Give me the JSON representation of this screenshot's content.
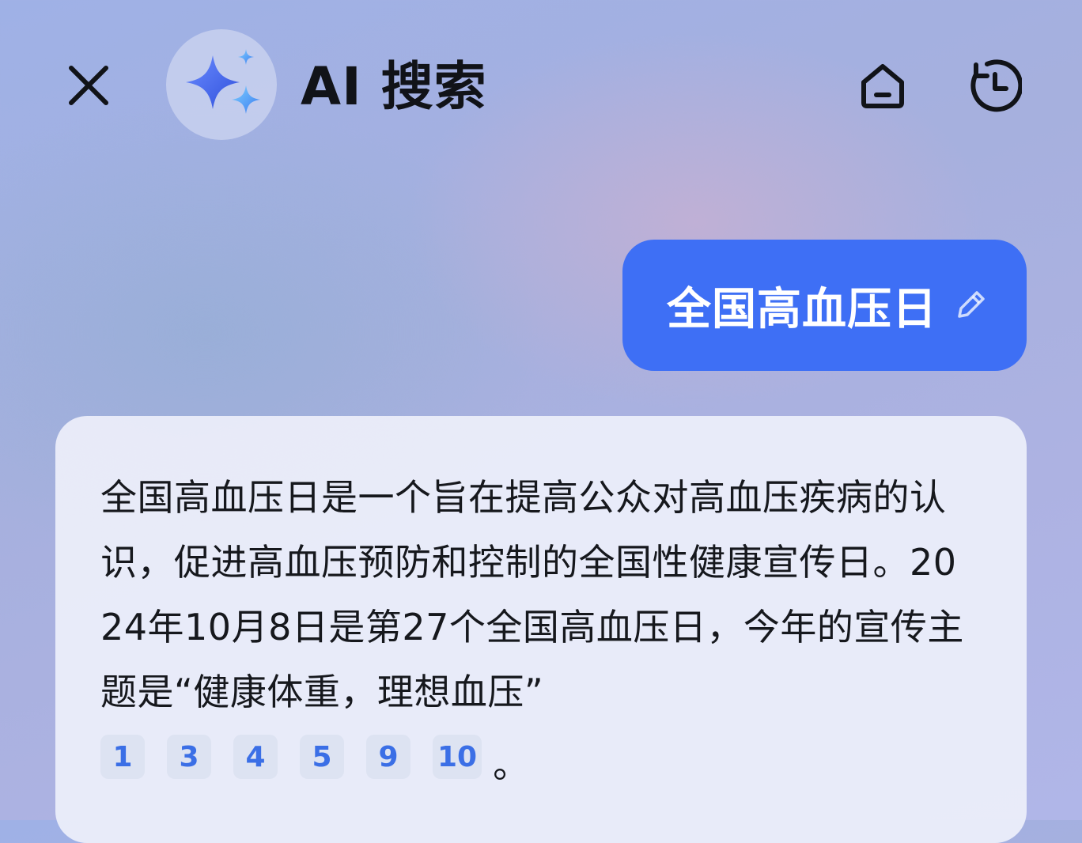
{
  "header": {
    "title": "AI 搜索",
    "close_icon": "close-icon",
    "logo_icon": "sparkle-icon",
    "home_icon": "home-icon",
    "history_icon": "history-icon"
  },
  "query": {
    "text": "全国高血压日",
    "edit_icon": "pencil-icon"
  },
  "answer": {
    "text": "全国高血压日是一个旨在提高公众对高血压疾病的认识，促进高血压预防和控制的全国性健康宣传日。2024年10月8日是第27个全国高血压日，今年的宣传主题是“健康体重，理想血压”",
    "citations": [
      "1",
      "3",
      "4",
      "5",
      "9",
      "10"
    ],
    "end_punct": "。"
  },
  "colors": {
    "accent": "#3e6ff5",
    "citation_text": "#3b6fe6",
    "citation_bg": "#dde3f2"
  }
}
